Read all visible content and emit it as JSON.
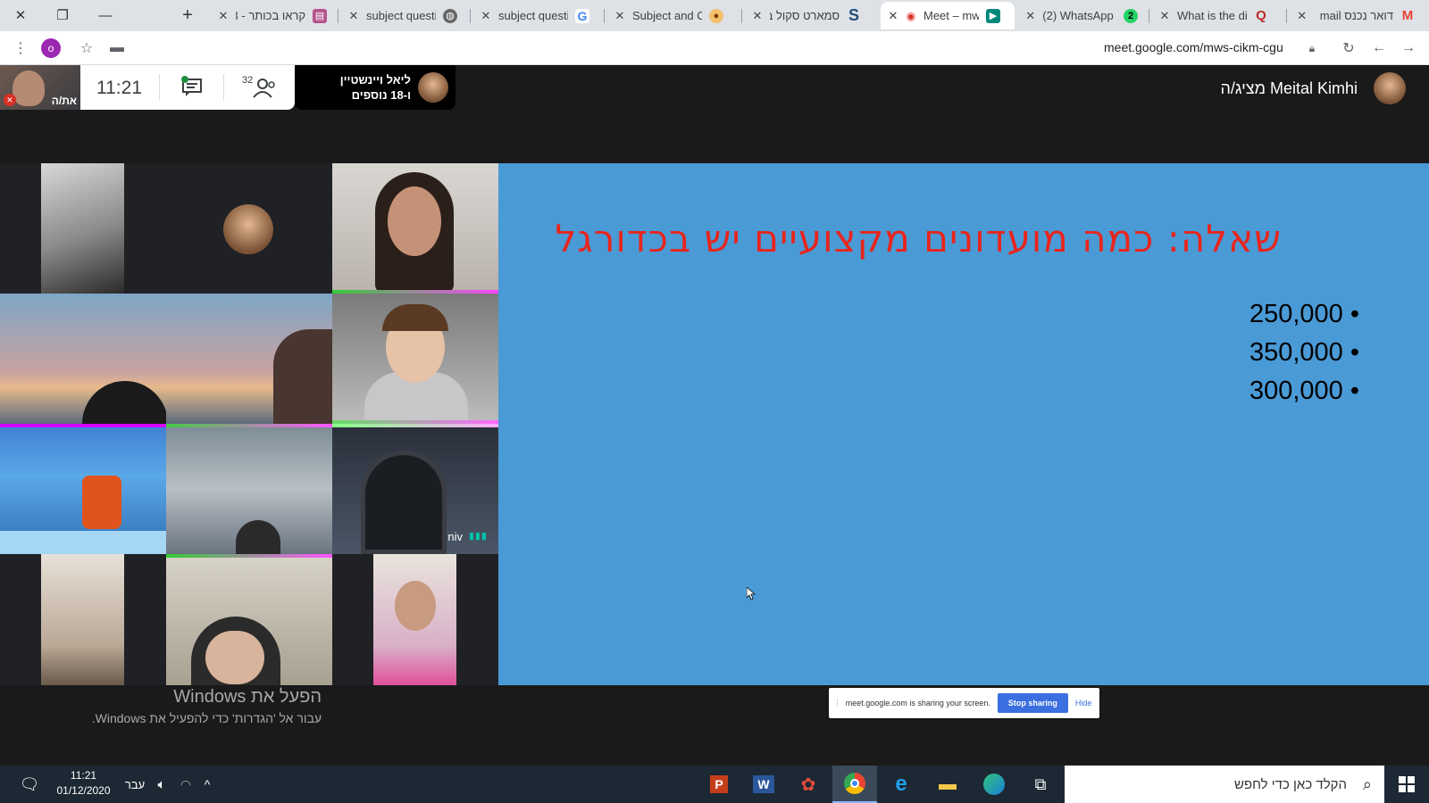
{
  "browser": {
    "tabs": [
      {
        "title": "קראו בכותר - 3",
        "favicon": "book-icon",
        "color": "#9c27b0"
      },
      {
        "title": "subject questic",
        "favicon": "globe-icon",
        "color": "#555"
      },
      {
        "title": "subject questic",
        "favicon": "google-icon",
        "color": "#4285f4"
      },
      {
        "title": "Subject and Ob",
        "favicon": "owl-icon",
        "color": "#f39c12"
      },
      {
        "title": "סמארט סקול ב",
        "favicon": "s-icon",
        "color": "#1f4e79"
      },
      {
        "title": "Meet – mw",
        "favicon": "meet-icon",
        "color": "#00897b",
        "active": true
      },
      {
        "title": "(2) WhatsApp",
        "favicon": "whatsapp-icon",
        "color": "#25d366",
        "badge": "2"
      },
      {
        "title": "What is the diffi",
        "favicon": "quora-icon",
        "color": "#b92b27"
      },
      {
        "title": "דואר נכנס mail",
        "favicon": "gmail-icon",
        "color": "#ea4335"
      }
    ],
    "profile_initial": "o",
    "url": "meet.google.com/mws-cikm-cgu"
  },
  "meet": {
    "self_label": "את/ה",
    "clock": "11:21",
    "participants_count": "32",
    "presenter_pill": {
      "line1": "ליאל ויינשטיין",
      "line2": "ו-18 נוספים"
    },
    "host": "Meital Kimhi מציג/ה",
    "tiles": [
      {
        "name": ""
      },
      {
        "name": ""
      },
      {
        "name": ""
      },
      {
        "name": ""
      },
      {
        "name": ""
      },
      {
        "name": ""
      },
      {
        "name": ""
      },
      {
        "name": ""
      },
      {
        "name": "niv"
      },
      {
        "name": ""
      },
      {
        "name": ""
      },
      {
        "name": ""
      }
    ]
  },
  "slide": {
    "title": "שאלה: כמה מועדונים מקצועיים יש בכדורגל",
    "options": [
      "250,000 •",
      "350,000 •",
      "300,000 •"
    ]
  },
  "share_bar": {
    "text": "meet.google.com is sharing your screen.",
    "stop_label": "Stop sharing",
    "hide_label": "Hide"
  },
  "windows_watermark": {
    "line1": "הפעל את Windows",
    "line2": "עבור אל 'הגדרות' כדי להפעיל את Windows."
  },
  "taskbar": {
    "time": "11:21",
    "date": "01/12/2020",
    "lang": "עבר",
    "search_placeholder": "הקלד כאן כדי לחפש"
  }
}
